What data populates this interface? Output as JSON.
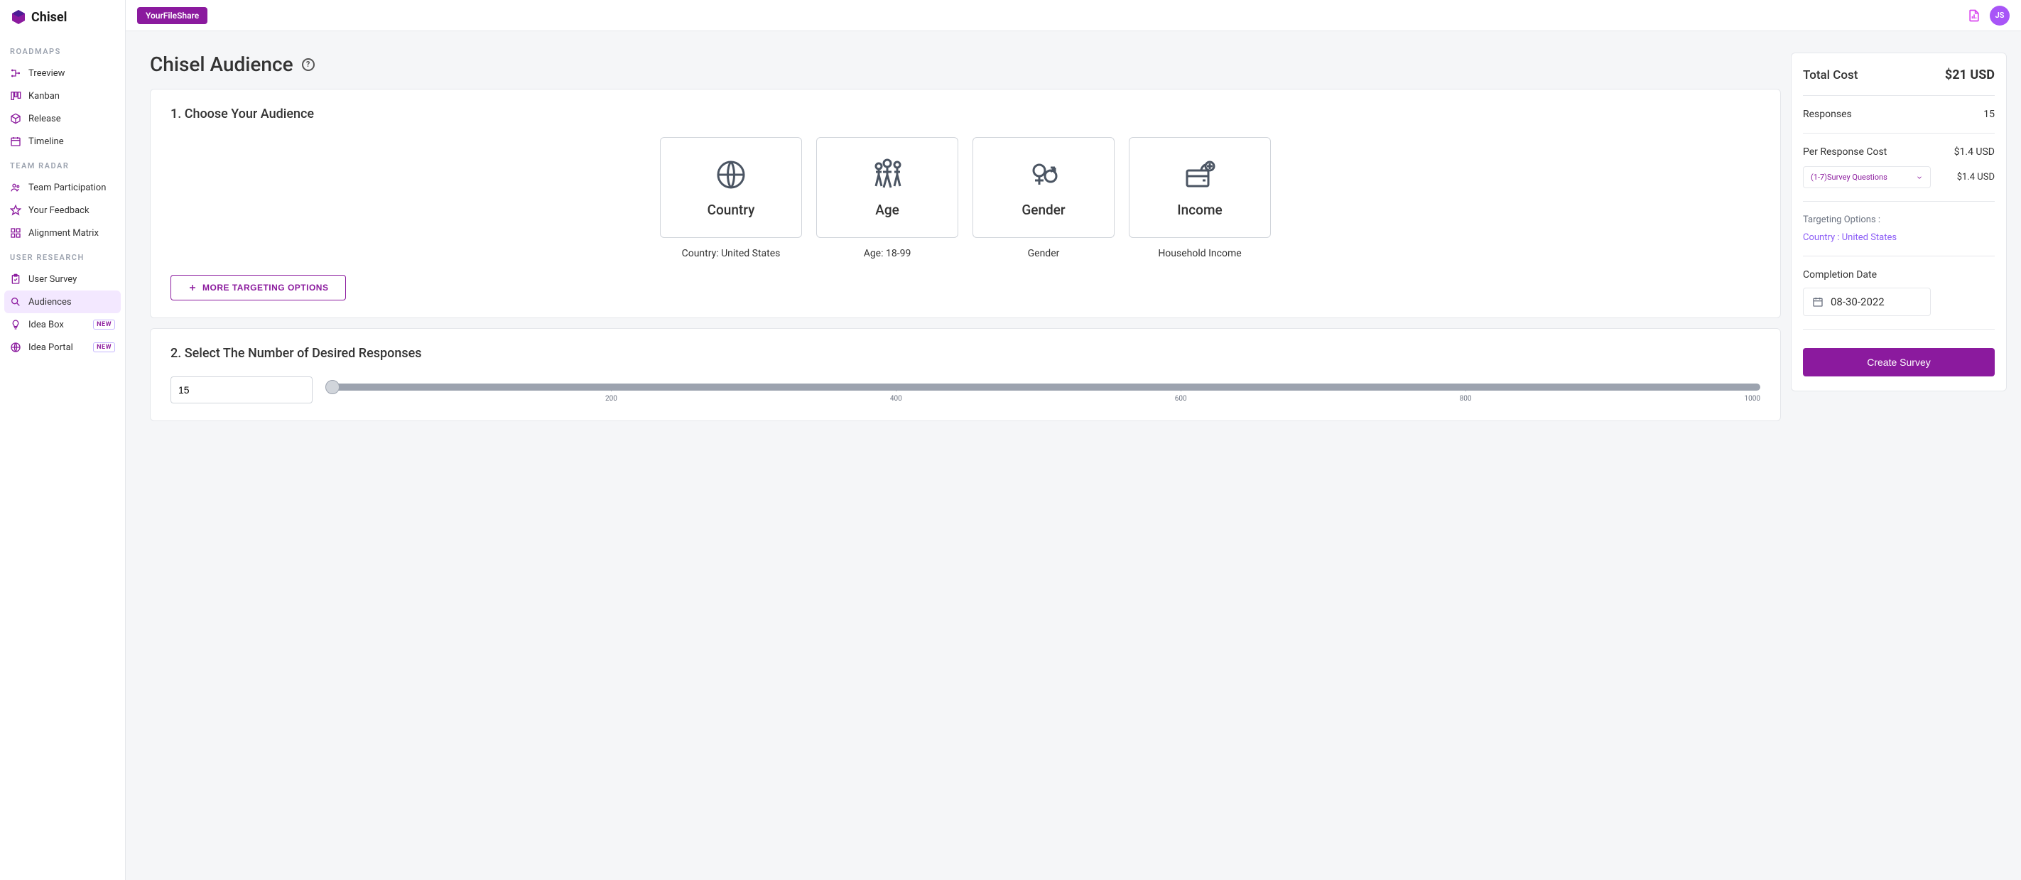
{
  "brand": {
    "name": "Chisel"
  },
  "topbar": {
    "project_name": "YourFileShare",
    "avatar_initials": "JS"
  },
  "sidebar": {
    "sections": [
      {
        "label": "ROADMAPS",
        "items": [
          {
            "label": "Treeview",
            "icon": "tree"
          },
          {
            "label": "Kanban",
            "icon": "kanban"
          },
          {
            "label": "Release",
            "icon": "box"
          },
          {
            "label": "Timeline",
            "icon": "calendar"
          }
        ]
      },
      {
        "label": "TEAM RADAR",
        "items": [
          {
            "label": "Team Participation",
            "icon": "people"
          },
          {
            "label": "Your Feedback",
            "icon": "star"
          },
          {
            "label": "Alignment Matrix",
            "icon": "grid"
          }
        ]
      },
      {
        "label": "USER RESEARCH",
        "items": [
          {
            "label": "User Survey",
            "icon": "clipboard"
          },
          {
            "label": "Audiences",
            "icon": "search",
            "active": true
          },
          {
            "label": "Idea Box",
            "icon": "bulb",
            "badge": "NEW"
          },
          {
            "label": "Idea Portal",
            "icon": "globe",
            "badge": "NEW"
          }
        ]
      }
    ]
  },
  "page": {
    "title": "Chisel Audience",
    "s1_heading": "1. Choose Your Audience",
    "s2_heading": "2. Select The Number of Desired Responses",
    "more_targeting_label": "MORE TARGETING OPTIONS",
    "audience_tiles": [
      {
        "title": "Country",
        "subtitle": "Country: United States",
        "icon": "globe"
      },
      {
        "title": "Age",
        "subtitle": "Age: 18-99",
        "icon": "family"
      },
      {
        "title": "Gender",
        "subtitle": "Gender",
        "icon": "gender"
      },
      {
        "title": "Income",
        "subtitle": "Household Income",
        "icon": "wallet"
      }
    ],
    "responses_value": "15",
    "slider_ticks": [
      "",
      "200",
      "400",
      "600",
      "800",
      "1000"
    ]
  },
  "summary": {
    "total_cost_label": "Total Cost",
    "total_cost_value": "$21 USD",
    "responses_label": "Responses",
    "responses_value": "15",
    "per_response_label": "Per Response Cost",
    "per_response_value": "$1.4 USD",
    "questions_dropdown": "(1-7)Survey Questions",
    "questions_price": "$1.4 USD",
    "targeting_label": "Targeting Options :",
    "targeting_value": "Country : United States",
    "completion_label": "Completion Date",
    "completion_value": "08-30-2022",
    "create_button": "Create Survey"
  }
}
